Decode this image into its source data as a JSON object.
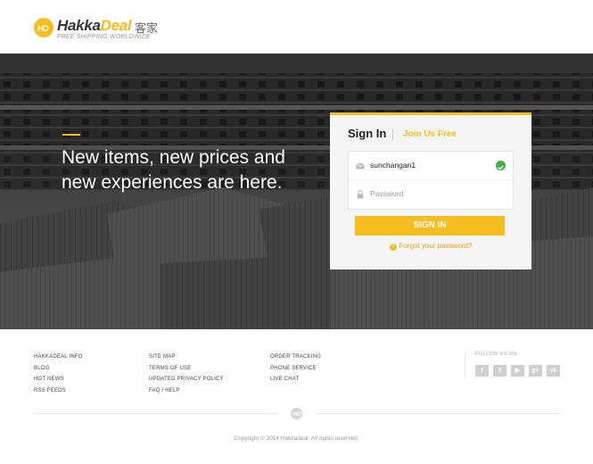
{
  "brand": {
    "name_part1": "Hakka",
    "name_part2": "Deal",
    "cjk": "客家",
    "tagline": "FREE SHIPPING WORLDWIDE"
  },
  "hero": {
    "headline": "New items, new prices and new experiences are here."
  },
  "signin": {
    "tab_signin": "Sign In",
    "tab_join": "Join Us Free",
    "username_value": "sunchangan1",
    "password_placeholder": "Password",
    "submit_label": "SIGN IN",
    "forgot_label": "Forgot your password?",
    "forgot_icon": "?"
  },
  "footer": {
    "col1": [
      "HAKKADEAL INFO",
      "BLOG",
      "HOT NEWS",
      "RSS FEEDS"
    ],
    "col2": [
      "SITE MAP",
      "TERMS OF USE",
      "UPDATED PRIVACY POLICY",
      "FAQ / HELP"
    ],
    "col3": [
      "ORDER TRACKING",
      "PHONE SERVICE",
      "LIVE CHAT"
    ],
    "follow_label": "FOLLOW US ON",
    "socials": [
      {
        "icon": "facebook-icon",
        "glyph": "f"
      },
      {
        "icon": "twitter-icon",
        "glyph": "t"
      },
      {
        "icon": "youtube-icon",
        "glyph": "▶"
      },
      {
        "icon": "googleplus-icon",
        "glyph": "g+"
      },
      {
        "icon": "vk-icon",
        "glyph": "vk"
      }
    ],
    "copyright": "Copyright © 2014 Hakkadeal. All rights reserved."
  },
  "colors": {
    "accent": "#f5bd1f",
    "success": "#3cb043"
  }
}
